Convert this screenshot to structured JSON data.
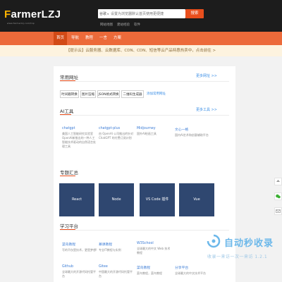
{
  "header": {
    "logo_first": "F",
    "logo_rest": "armerLZJ",
    "logo_sub": "www.farmerlzj.com/top",
    "search": {
      "engine": "谷歌",
      "placeholder": "设置为浏览器默认首页使用更便捷",
      "button_label": "搜索"
    },
    "sub_links": [
      "网站地图",
      "建站经验",
      "软件"
    ]
  },
  "nav": {
    "items": [
      "首页",
      "导航",
      "教程",
      "一言",
      "方案"
    ],
    "active_index": 0
  },
  "notice": {
    "text": "【提示云】云服务器、云数据库、CDN、CDN、短信等云产品特惠热卖中，点击前往 >"
  },
  "common": {
    "title": "常用网址",
    "more": "更多网址 >>",
    "tags": [
      "时间戳转换",
      "图片压缩",
      "JSON格式转换",
      "二维码生成器"
    ],
    "add_label": "添加常用网址"
  },
  "ai": {
    "title": "AI工具",
    "more": "更多工具 >>",
    "items": [
      {
        "name": "chatgpt",
        "desc": "美国人工智能研究实验室OpenAI新推出的一种人工智能技术驱动的自然语言处理工具"
      },
      {
        "name": "chatgpt-plus",
        "desc": "由 OpenAI 公司推出的针对 ChatGPT 的付费订阅计划"
      },
      {
        "name": "Midjourney",
        "desc": "国外AI绘画工具"
      },
      {
        "name": "文心一格",
        "desc": "国内AI艺术和创意辅助平台"
      }
    ]
  },
  "topics": {
    "title": "专题汇总",
    "items": [
      "React",
      "Node",
      "VS Code 插件",
      "Vue"
    ]
  },
  "learning": {
    "title": "学习平台",
    "items": [
      {
        "name": "菜鸟教程",
        "desc": "写的不仅是技术，更是梦想!"
      },
      {
        "name": "慕课教程",
        "desc": "专业IT教程与实例"
      },
      {
        "name": "W3School",
        "desc": "全球最大的中文 Web 技术教程"
      },
      {
        "name": "Github",
        "desc": "全球最大的开源代码托管平台"
      },
      {
        "name": "Gitee",
        "desc": "中国最大的开源代码托管平台"
      },
      {
        "name": "菜鸟教程",
        "desc": "菜鸟教程，菜鸟教程"
      },
      {
        "name": "分享平台",
        "desc": "全球最大的中文技术平台"
      }
    ]
  },
  "watermark": {
    "title": "自动秒收录",
    "sub": "收录一来访一次一来访 1.2.1"
  },
  "colors": {
    "accent": "#ec6a3a",
    "nav_active": "#d24a16",
    "link": "#3a7bd5",
    "topic_bg": "#2f4770",
    "header_bg": "#1c1c1c"
  }
}
